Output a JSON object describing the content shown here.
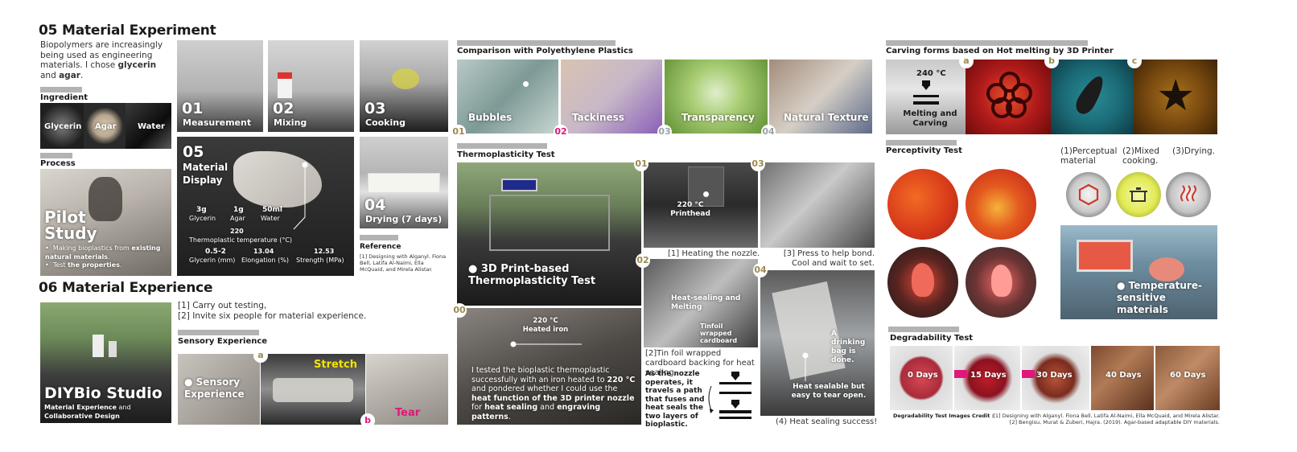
{
  "s05": {
    "title": "05 Material Experiment",
    "intro_a": "Biopolymers are increasingly being used as engineering materials. I chose ",
    "glycerin": "glycerin",
    "and": " and ",
    "agar": "agar",
    "period": ".",
    "ingredient": "Ingredient",
    "ingredients": [
      "Glycerin",
      "Agar",
      "Water"
    ],
    "process": "Process",
    "pilot": "Pilot Study",
    "pilot_b1a": "Making bioplastics from ",
    "pilot_b1b": "existing natural materials",
    "pilot_b1c": ".",
    "pilot_b2a": "Test ",
    "pilot_b2b": "the properties",
    "pilot_b2c": ".",
    "steps": [
      {
        "num": "01",
        "label": "Measurement"
      },
      {
        "num": "02",
        "label": "Mixing"
      },
      {
        "num": "03",
        "label": "Cooking"
      },
      {
        "num": "04",
        "label": "Drying (7 days)"
      }
    ],
    "display_num": "05",
    "display_label": "Material Display",
    "amounts": [
      {
        "v": "3g",
        "l": "Glycerin"
      },
      {
        "v": "1g",
        "l": "Agar"
      },
      {
        "v": "50ml",
        "l": "Water"
      }
    ],
    "temp_val": "220",
    "temp_label": "Thermoplastic temperature (°C)",
    "props": [
      {
        "v": "0.5-2",
        "l": "Glycerin (mm)"
      },
      {
        "v": "13.04",
        "l": "Elongation (%)"
      },
      {
        "v": "12.53",
        "l": "Strength (MPa)"
      }
    ],
    "reference": "Reference",
    "reference_text": "[1] Designing with Alganyl. Fiona Bell, Latifa Al-Naimi, Ella McQuaid, and Mirela Alistar."
  },
  "s06": {
    "title": "06 Material Experience",
    "diybio": "DIYBio Studio",
    "diybio_a": "Material Experience",
    "diybio_and": " and",
    "diybio_b": "Collaborative Design",
    "line1": "[1] Carry out testing,",
    "line2": "[2] Invite six people for material experience.",
    "sensory": "Sensory Experience",
    "sensory_label": "Sensory Experience",
    "stretch": "Stretch",
    "tear": "Tear",
    "badge_a": "a",
    "badge_b": "b"
  },
  "comparison": {
    "title": "Comparison with Polyethylene Plastics",
    "items": [
      {
        "num": "01",
        "label": "Bubbles"
      },
      {
        "num": "02",
        "label": "Tackiness"
      },
      {
        "num": "03",
        "label": "Transparency"
      },
      {
        "num": "04",
        "label": "Natural Texture"
      }
    ]
  },
  "thermo": {
    "title": "Thermoplasticity  Test",
    "main_label": "3D Print-based Thermoplasticity Test",
    "s00": "00",
    "iron": "220 °C Heated iron",
    "body_a": "I tested the bioplastic thermoplastic successfully with an iron heated to ",
    "body_b": "220 °C",
    "body_c": " and pondered whether I could use the ",
    "body_d": "heat function of the 3D printer nozzle",
    "body_e": " for ",
    "body_f": "heat sealing",
    "body_g": " and ",
    "body_h": "engraving patterns",
    "body_i": ".",
    "s01": "01",
    "printhead": "220 °C Printhead",
    "cap1": "[1] Heating the nozzle.",
    "s02": "02",
    "heatseal": "Heat-sealing and Melting",
    "tinfoil": "Tinfoil wrapped cardboard",
    "cap2": "[2]Tin foil wrapped cardboard backing for heat sealing.",
    "nozzle_text": "As the nozzle operates, it travels a path that fuses and heat seals the two layers of bioplastic.",
    "s03": "03",
    "cap3": "[3] Press to help bond. Cool and wait to set.",
    "s04": "04",
    "drinking": "A drinking bag is done.",
    "sealable": "Heat sealable but easy to tear open.",
    "cap4": "(4) Heat sealing success!"
  },
  "carving": {
    "title": "Carving forms based on Hot melting by 3D Printer",
    "temp": "240 °C",
    "melt": "Melting and Carving",
    "badges": [
      "a",
      "b",
      "c"
    ]
  },
  "percept": {
    "title": "Perceptivity  Test",
    "steps": [
      "(1)Perceptual material",
      "(2)Mixed cooking.",
      "(3)Drying."
    ],
    "temp_label": "Temperature-sensitive materials"
  },
  "degrade": {
    "title": "Degradability Test",
    "days": [
      "0 Days",
      "15 Days",
      "30 Days",
      "40 Days",
      "60 Days"
    ],
    "credit_label": "Degradability Test Images Credit :",
    "credit_1": "[1] Designing with Alganyl. Fiona Bell, Latifa Al-Naimi, Ella McQuaid, and Mirela Alistar.",
    "credit_2": "[2] Bengisu, Murat & Zuberi, Hajra. (2019). Agar-based adaptable DIY materials."
  },
  "colors": {
    "bar": "#b3b3b3",
    "accent_gold": "#9c8a4e",
    "accent_magenta": "#e0187a",
    "accent_yellow": "#f4e400",
    "accent_grey": "#9aa3a8"
  }
}
